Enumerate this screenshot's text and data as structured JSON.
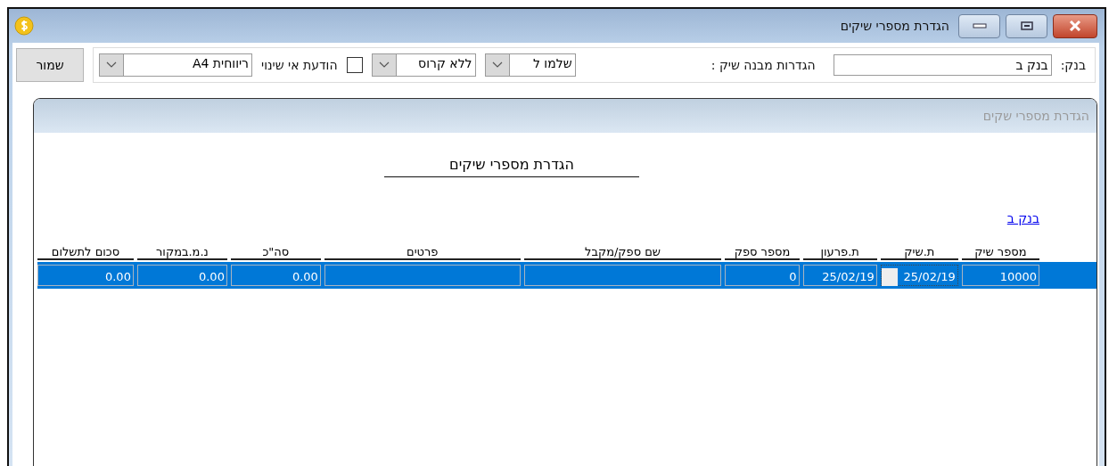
{
  "window": {
    "title": "הגדרת מספרי שיקים"
  },
  "toolbar": {
    "bank_label": "בנק:",
    "bank_field": {
      "value": "בנק ב"
    },
    "structure_label": "הגדרות מבנה שיק :",
    "combos": [
      {
        "value": "שלמו ל"
      },
      {
        "value": "ללא קרוס"
      }
    ],
    "notice_checkbox": {
      "checked": false,
      "label": "הודעת אי שינוי"
    },
    "layout_combo": {
      "value": "ריווחית A4"
    },
    "save_button": "שמור"
  },
  "panel": {
    "title": "הגדרת מספרי שקים",
    "report_title": "הגדרת מספרי שיקים",
    "bank_link": "בנק ב",
    "table": {
      "columns": [
        "מספר שיק",
        "ת.שיק",
        "ת.פרעון",
        "מספר ספק",
        "שם ספק/מקבל",
        "פרטים",
        "סה\"כ",
        "נ.מ.במקור",
        "סכום לתשלום"
      ],
      "rows": [
        {
          "selected": true,
          "cells": [
            {
              "text": "10000",
              "focused": false
            },
            {
              "text": "25/02/19",
              "focused": true
            },
            {
              "text": "25/02/19",
              "focused": false
            },
            {
              "text": "0",
              "focused": false
            },
            {
              "text": "",
              "focused": false
            },
            {
              "text": "",
              "focused": false
            },
            {
              "text": "0.00",
              "focused": false
            },
            {
              "text": "0.00",
              "focused": false
            },
            {
              "text": "0.00",
              "focused": false
            }
          ]
        }
      ]
    }
  }
}
